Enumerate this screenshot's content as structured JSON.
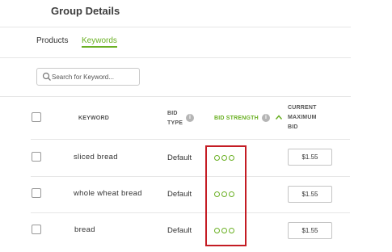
{
  "header": {
    "title": "Group Details"
  },
  "tabs": [
    {
      "label": "Products",
      "active": false
    },
    {
      "label": "Keywords",
      "active": true
    }
  ],
  "search": {
    "placeholder": "Search for Keyword...",
    "value": "",
    "icon": "search-icon"
  },
  "table": {
    "columns": {
      "keyword": "KEYWORD",
      "bid_type": [
        "BID",
        "TYPE"
      ],
      "bid_strength": "BID STRENGTH",
      "current_max_bid": [
        "CURRENT",
        "MAXIMUM",
        "BID"
      ]
    },
    "rows": [
      {
        "keyword": "sliced bread",
        "bid_type": "Default",
        "strength": "3 empty circles",
        "max_bid": "$1.55"
      },
      {
        "keyword": "whole wheat bread",
        "bid_type": "Default",
        "strength": "3 empty circles",
        "max_bid": "$1.55"
      },
      {
        "keyword": "bread",
        "bid_type": "Default",
        "strength": "3 empty circles",
        "max_bid": "$1.55"
      }
    ]
  },
  "colors": {
    "accent": "#6ab023",
    "highlight": "#c41c24",
    "text": "#333333",
    "border": "#e6e6e6"
  },
  "icons": {
    "info": "info-icon",
    "sort": "sort-ascending-icon"
  },
  "info_glyph": "i"
}
